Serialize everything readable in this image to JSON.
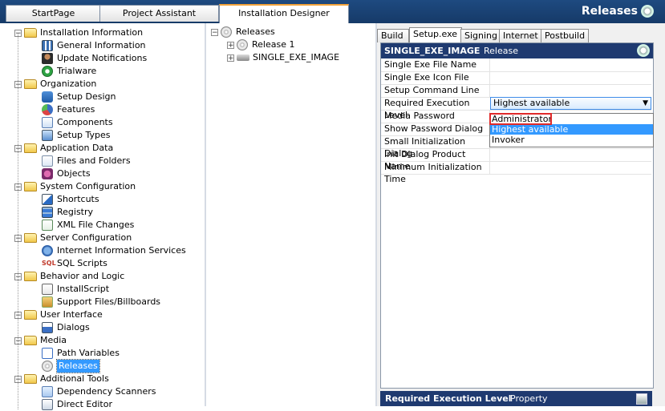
{
  "top_tabs": [
    "StartPage",
    "Project Assistant",
    "Installation Designer"
  ],
  "title": "Releases",
  "left_tree": [
    {
      "label": "Installation Information",
      "kind": "folder",
      "depth": 0
    },
    {
      "label": "General Information",
      "kind": "i-grid",
      "depth": 1
    },
    {
      "label": "Update Notifications",
      "kind": "i-user",
      "depth": 1
    },
    {
      "label": "Trialware",
      "kind": "i-power",
      "depth": 1
    },
    {
      "label": "Organization",
      "kind": "folder",
      "depth": 0
    },
    {
      "label": "Setup Design",
      "kind": "i-setup",
      "depth": 1
    },
    {
      "label": "Features",
      "kind": "i-features",
      "depth": 1
    },
    {
      "label": "Components",
      "kind": "i-comp",
      "depth": 1
    },
    {
      "label": "Setup Types",
      "kind": "i-types",
      "depth": 1
    },
    {
      "label": "Application Data",
      "kind": "folder",
      "depth": 0
    },
    {
      "label": "Files and Folders",
      "kind": "i-files",
      "depth": 1
    },
    {
      "label": "Objects",
      "kind": "i-obj",
      "depth": 1
    },
    {
      "label": "System Configuration",
      "kind": "folder",
      "depth": 0
    },
    {
      "label": "Shortcuts",
      "kind": "i-short",
      "depth": 1
    },
    {
      "label": "Registry",
      "kind": "i-reg",
      "depth": 1
    },
    {
      "label": "XML File Changes",
      "kind": "i-xml",
      "depth": 1
    },
    {
      "label": "Server Configuration",
      "kind": "folder",
      "depth": 0
    },
    {
      "label": "Internet Information Services",
      "kind": "i-iis",
      "depth": 1
    },
    {
      "label": "SQL Scripts",
      "kind": "i-sql",
      "depth": 1
    },
    {
      "label": "Behavior and Logic",
      "kind": "folder",
      "depth": 0
    },
    {
      "label": "InstallScript",
      "kind": "i-script",
      "depth": 1
    },
    {
      "label": "Support Files/Billboards",
      "kind": "i-support",
      "depth": 1
    },
    {
      "label": "User Interface",
      "kind": "folder",
      "depth": 0
    },
    {
      "label": "Dialogs",
      "kind": "i-dialog",
      "depth": 1
    },
    {
      "label": "Media",
      "kind": "folder",
      "depth": 0
    },
    {
      "label": "Path Variables",
      "kind": "i-path",
      "depth": 1
    },
    {
      "label": "Releases",
      "kind": "i-cd",
      "depth": 1,
      "selected": true
    },
    {
      "label": "Additional Tools",
      "kind": "folder",
      "depth": 0
    },
    {
      "label": "Dependency Scanners",
      "kind": "i-dep",
      "depth": 1
    },
    {
      "label": "Direct Editor",
      "kind": "i-direct",
      "depth": 1
    }
  ],
  "mid_tree": [
    {
      "label": "Releases",
      "kind": "i-cd",
      "depth": 0,
      "exp": "-"
    },
    {
      "label": "Release 1",
      "kind": "i-cd",
      "depth": 1,
      "exp": "+"
    },
    {
      "label": "SINGLE_EXE_IMAGE",
      "kind": "drive",
      "depth": 1,
      "exp": "+"
    }
  ],
  "setting_tabs": [
    "Build",
    "Setup.exe",
    "Signing",
    "Internet",
    "Postbuild"
  ],
  "active_setting_tab": "Setup.exe",
  "grid_header": {
    "name": "SINGLE_EXE_IMAGE",
    "type": "Release"
  },
  "properties": [
    {
      "name": "Single Exe File Name",
      "value": ""
    },
    {
      "name": "Single Exe Icon File",
      "value": ""
    },
    {
      "name": "Setup Command Line",
      "value": ""
    },
    {
      "name": "Required Execution Level",
      "value": "Highest available"
    },
    {
      "name": "Media Password",
      "value": ""
    },
    {
      "name": "Show Password Dialog",
      "value": ""
    },
    {
      "name": "Small Initialization Dialog",
      "value": ""
    },
    {
      "name": "Init Dialog Product Name",
      "value": ""
    },
    {
      "name": "Minimum Initialization Time",
      "value": ""
    }
  ],
  "dropdown_options": [
    "Administrator",
    "Highest available",
    "Invoker"
  ],
  "dropdown_highlight": "Highest available",
  "dropdown_boxed": "Administrator",
  "help_bar": {
    "title": "Required Execution Level",
    "kind": "Property"
  }
}
